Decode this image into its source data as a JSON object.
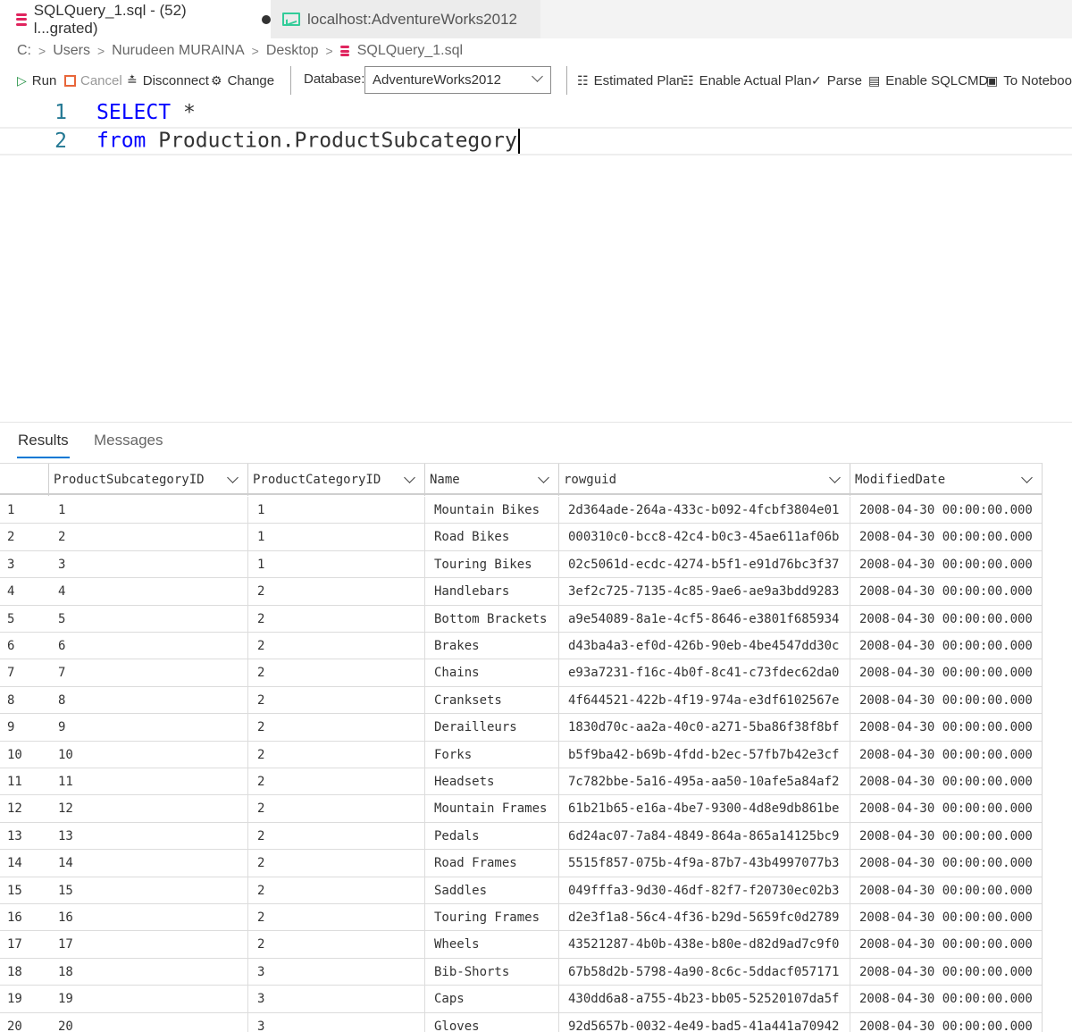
{
  "tabs": [
    {
      "label": "SQLQuery_1.sql - (52) l...grated)",
      "dirty": true,
      "active": true
    },
    {
      "label": "localhost:AdventureWorks2012",
      "active": false
    }
  ],
  "breadcrumb": [
    "C:",
    "Users",
    "Nurudeen MURAINA",
    "Desktop",
    "SQLQuery_1.sql"
  ],
  "toolbar": {
    "run": "Run",
    "cancel": "Cancel",
    "disconnect": "Disconnect",
    "change": "Change",
    "database_label": "Database:",
    "database_value": "AdventureWorks2012",
    "estimated_plan": "Estimated Plan",
    "enable_actual_plan": "Enable Actual Plan",
    "parse": "Parse",
    "enable_sqlcmd": "Enable SQLCMD",
    "to_notebook": "To Noteboo"
  },
  "editor": {
    "lines": [
      {
        "number": "1",
        "keyword": "SELECT",
        "rest": " *"
      },
      {
        "number": "2",
        "keyword": "from",
        "rest": " Production.ProductSubcategory"
      }
    ]
  },
  "results": {
    "tabs": [
      "Results",
      "Messages"
    ],
    "columns": [
      "ProductSubcategoryID",
      "ProductCategoryID",
      "Name",
      "rowguid",
      "ModifiedDate"
    ],
    "rows": [
      [
        "1",
        "1",
        "1",
        "Mountain Bikes",
        "2d364ade-264a-433c-b092-4fcbf3804e01",
        "2008-04-30 00:00:00.000"
      ],
      [
        "2",
        "2",
        "1",
        "Road Bikes",
        "000310c0-bcc8-42c4-b0c3-45ae611af06b",
        "2008-04-30 00:00:00.000"
      ],
      [
        "3",
        "3",
        "1",
        "Touring Bikes",
        "02c5061d-ecdc-4274-b5f1-e91d76bc3f37",
        "2008-04-30 00:00:00.000"
      ],
      [
        "4",
        "4",
        "2",
        "Handlebars",
        "3ef2c725-7135-4c85-9ae6-ae9a3bdd9283",
        "2008-04-30 00:00:00.000"
      ],
      [
        "5",
        "5",
        "2",
        "Bottom Brackets",
        "a9e54089-8a1e-4cf5-8646-e3801f685934",
        "2008-04-30 00:00:00.000"
      ],
      [
        "6",
        "6",
        "2",
        "Brakes",
        "d43ba4a3-ef0d-426b-90eb-4be4547dd30c",
        "2008-04-30 00:00:00.000"
      ],
      [
        "7",
        "7",
        "2",
        "Chains",
        "e93a7231-f16c-4b0f-8c41-c73fdec62da0",
        "2008-04-30 00:00:00.000"
      ],
      [
        "8",
        "8",
        "2",
        "Cranksets",
        "4f644521-422b-4f19-974a-e3df6102567e",
        "2008-04-30 00:00:00.000"
      ],
      [
        "9",
        "9",
        "2",
        "Derailleurs",
        "1830d70c-aa2a-40c0-a271-5ba86f38f8bf",
        "2008-04-30 00:00:00.000"
      ],
      [
        "10",
        "10",
        "2",
        "Forks",
        "b5f9ba42-b69b-4fdd-b2ec-57fb7b42e3cf",
        "2008-04-30 00:00:00.000"
      ],
      [
        "11",
        "11",
        "2",
        "Headsets",
        "7c782bbe-5a16-495a-aa50-10afe5a84af2",
        "2008-04-30 00:00:00.000"
      ],
      [
        "12",
        "12",
        "2",
        "Mountain Frames",
        "61b21b65-e16a-4be7-9300-4d8e9db861be",
        "2008-04-30 00:00:00.000"
      ],
      [
        "13",
        "13",
        "2",
        "Pedals",
        "6d24ac07-7a84-4849-864a-865a14125bc9",
        "2008-04-30 00:00:00.000"
      ],
      [
        "14",
        "14",
        "2",
        "Road Frames",
        "5515f857-075b-4f9a-87b7-43b4997077b3",
        "2008-04-30 00:00:00.000"
      ],
      [
        "15",
        "15",
        "2",
        "Saddles",
        "049fffa3-9d30-46df-82f7-f20730ec02b3",
        "2008-04-30 00:00:00.000"
      ],
      [
        "16",
        "16",
        "2",
        "Touring Frames",
        "d2e3f1a8-56c4-4f36-b29d-5659fc0d2789",
        "2008-04-30 00:00:00.000"
      ],
      [
        "17",
        "17",
        "2",
        "Wheels",
        "43521287-4b0b-438e-b80e-d82d9ad7c9f0",
        "2008-04-30 00:00:00.000"
      ],
      [
        "18",
        "18",
        "3",
        "Bib-Shorts",
        "67b58d2b-5798-4a90-8c6c-5ddacf057171",
        "2008-04-30 00:00:00.000"
      ],
      [
        "19",
        "19",
        "3",
        "Caps",
        "430dd6a8-a755-4b23-bb05-52520107da5f",
        "2008-04-30 00:00:00.000"
      ],
      [
        "20",
        "20",
        "3",
        "Gloves",
        "92d5657b-0032-4e49-bad5-41a441a70942",
        "2008-04-30 00:00:00.000"
      ]
    ]
  }
}
